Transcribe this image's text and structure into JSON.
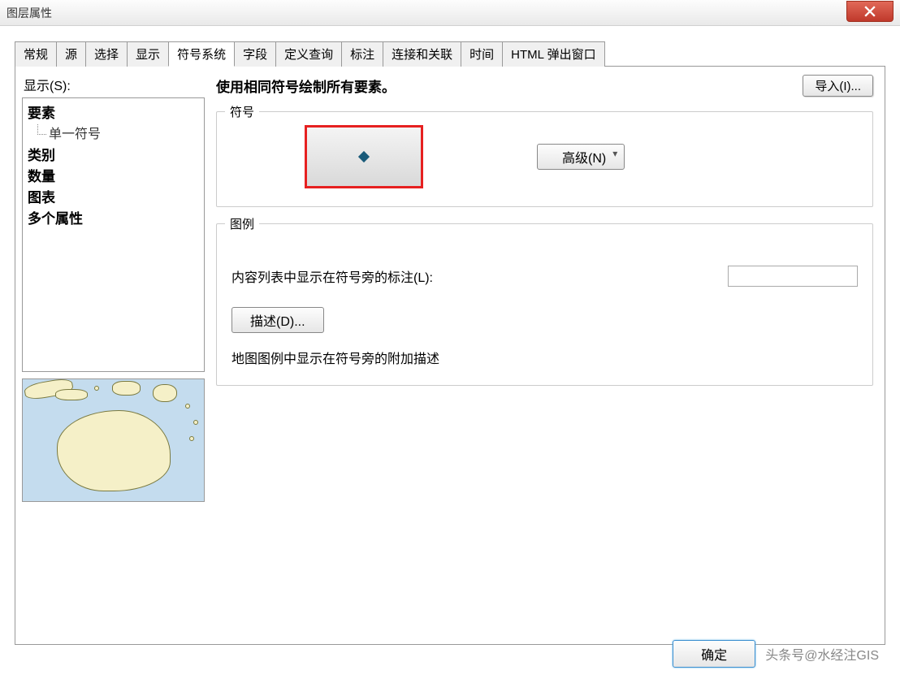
{
  "window": {
    "title": "图层属性"
  },
  "tabs": [
    {
      "label": "常规"
    },
    {
      "label": "源"
    },
    {
      "label": "选择"
    },
    {
      "label": "显示"
    },
    {
      "label": "符号系统",
      "active": true
    },
    {
      "label": "字段"
    },
    {
      "label": "定义查询"
    },
    {
      "label": "标注"
    },
    {
      "label": "连接和关联"
    },
    {
      "label": "时间"
    },
    {
      "label": "HTML 弹出窗口"
    }
  ],
  "sidebar": {
    "header": "显示(S):",
    "items": {
      "features": "要素",
      "single_symbol": "单一符号",
      "categories": "类别",
      "quantities": "数量",
      "charts": "图表",
      "multiple_attrs": "多个属性"
    }
  },
  "main": {
    "heading": "使用相同符号绘制所有要素。",
    "import_btn": "导入(I)...",
    "symbol_group": "符号",
    "advanced_btn": "高级(N)",
    "legend_group": "图例",
    "legend_label": "内容列表中显示在符号旁的标注(L):",
    "legend_value": "",
    "describe_btn": "描述(D)...",
    "describe_text": "地图图例中显示在符号旁的附加描述"
  },
  "footer": {
    "ok": "确定",
    "watermark": "头条号@水经注GIS"
  }
}
